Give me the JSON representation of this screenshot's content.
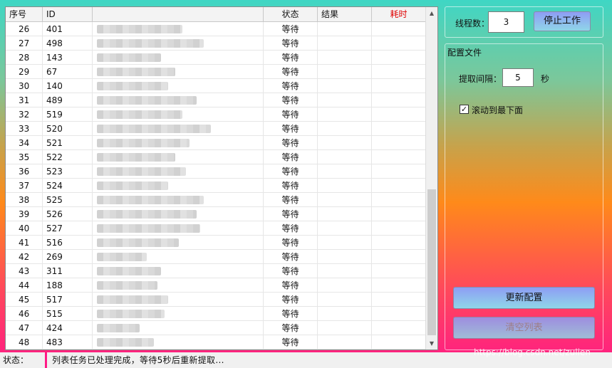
{
  "list": {
    "columns": {
      "seq": "序号",
      "id": "ID",
      "name": "",
      "status": "状态",
      "result": "结果",
      "time": "耗时"
    },
    "rows": [
      {
        "seq": "26",
        "id": "401",
        "status": "等待",
        "result": "",
        "time": ""
      },
      {
        "seq": "27",
        "id": "498",
        "status": "等待",
        "result": "",
        "time": ""
      },
      {
        "seq": "28",
        "id": "143",
        "status": "等待",
        "result": "",
        "time": ""
      },
      {
        "seq": "29",
        "id": "67",
        "status": "等待",
        "result": "",
        "time": ""
      },
      {
        "seq": "30",
        "id": "140",
        "status": "等待",
        "result": "",
        "time": ""
      },
      {
        "seq": "31",
        "id": "489",
        "status": "等待",
        "result": "",
        "time": ""
      },
      {
        "seq": "32",
        "id": "519",
        "status": "等待",
        "result": "",
        "time": ""
      },
      {
        "seq": "33",
        "id": "520",
        "status": "等待",
        "result": "",
        "time": ""
      },
      {
        "seq": "34",
        "id": "521",
        "status": "等待",
        "result": "",
        "time": ""
      },
      {
        "seq": "35",
        "id": "522",
        "status": "等待",
        "result": "",
        "time": ""
      },
      {
        "seq": "36",
        "id": "523",
        "status": "等待",
        "result": "",
        "time": ""
      },
      {
        "seq": "37",
        "id": "524",
        "status": "等待",
        "result": "",
        "time": ""
      },
      {
        "seq": "38",
        "id": "525",
        "status": "等待",
        "result": "",
        "time": ""
      },
      {
        "seq": "39",
        "id": "526",
        "status": "等待",
        "result": "",
        "time": ""
      },
      {
        "seq": "40",
        "id": "527",
        "status": "等待",
        "result": "",
        "time": ""
      },
      {
        "seq": "41",
        "id": "516",
        "status": "等待",
        "result": "",
        "time": ""
      },
      {
        "seq": "42",
        "id": "269",
        "status": "等待",
        "result": "",
        "time": ""
      },
      {
        "seq": "43",
        "id": "311",
        "status": "等待",
        "result": "",
        "time": ""
      },
      {
        "seq": "44",
        "id": "188",
        "status": "等待",
        "result": "",
        "time": ""
      },
      {
        "seq": "45",
        "id": "517",
        "status": "等待",
        "result": "",
        "time": ""
      },
      {
        "seq": "46",
        "id": "515",
        "status": "等待",
        "result": "",
        "time": ""
      },
      {
        "seq": "47",
        "id": "424",
        "status": "等待",
        "result": "",
        "time": ""
      },
      {
        "seq": "48",
        "id": "483",
        "status": "等待",
        "result": "",
        "time": ""
      }
    ]
  },
  "threads": {
    "label": "线程数：",
    "value": "3",
    "stop_button": "停止工作"
  },
  "config": {
    "group_title": "配置文件",
    "interval_label": "提取间隔：",
    "interval_value": "5",
    "interval_unit": "秒",
    "scroll_checkbox_label": "滚动到最下面",
    "scroll_checked": true,
    "update_button": "更新配置",
    "clear_button": "清空列表"
  },
  "statusbar": {
    "label": "状态：",
    "message": "列表任务已处理完成，等待5秒后重新提取..."
  },
  "watermark": "https://blog.csdn.net/zulien",
  "colors": {
    "time_header": "#e00000",
    "status_divider": "#ff1a86",
    "button_gradient_top": "#8e9df5",
    "button_gradient_bottom": "#8fd6e8"
  }
}
